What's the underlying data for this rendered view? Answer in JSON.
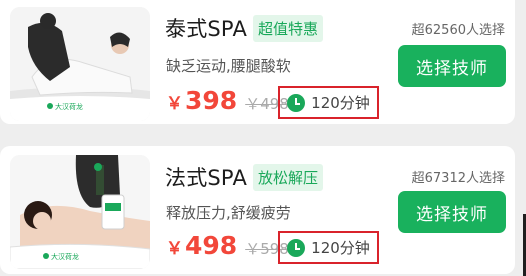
{
  "cards": [
    {
      "title": "泰式SPA",
      "tag": "超值特惠",
      "desc": "缺乏运动,腰腿酸软",
      "currency": "￥",
      "price": "398",
      "orig_price": "￥498",
      "duration": "120分钟",
      "sold": "超62560人选择",
      "button": "选择技师",
      "logo_text": "大汉荷龙"
    },
    {
      "title": "法式SPA",
      "tag": "放松解压",
      "desc": "释放压力,舒缓疲劳",
      "currency": "￥",
      "price": "498",
      "orig_price": "￥598",
      "duration": "120分钟",
      "sold": "超67312人选择",
      "button": "选择技师",
      "logo_text": "大汉荷龙"
    }
  ],
  "colors": {
    "accent": "#19b15d",
    "price": "#f2473a",
    "highlight_box": "#d9232b"
  }
}
